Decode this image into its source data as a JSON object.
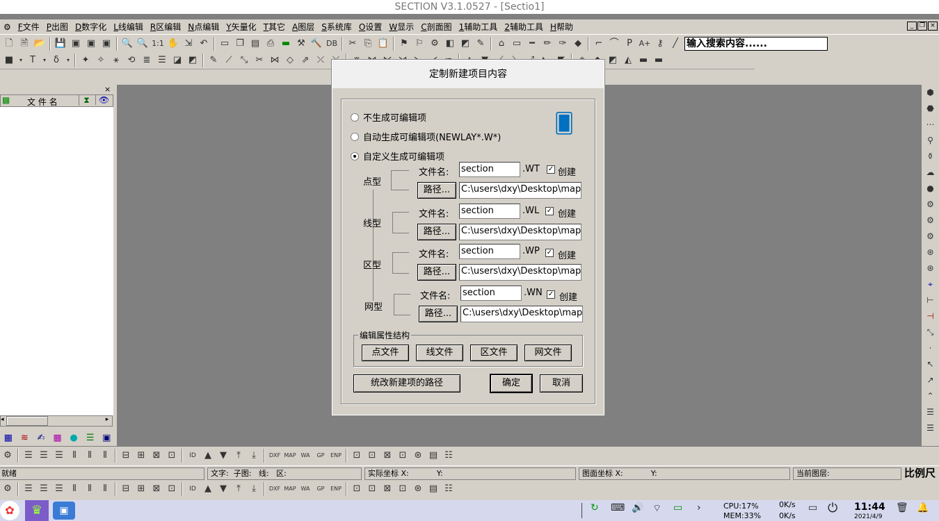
{
  "app": {
    "title": "SECTION V3.1.0527 - [Sectio1]"
  },
  "menu": {
    "items": [
      {
        "key": "F",
        "label": "文件"
      },
      {
        "key": "P",
        "label": "出图"
      },
      {
        "key": "D",
        "label": "数字化"
      },
      {
        "key": "L",
        "label": "线编辑"
      },
      {
        "key": "R",
        "label": "区编辑"
      },
      {
        "key": "N",
        "label": "点编辑"
      },
      {
        "key": "Y",
        "label": "矢量化"
      },
      {
        "key": "T",
        "label": "其它"
      },
      {
        "key": "A",
        "label": "图层"
      },
      {
        "key": "S",
        "label": "系统库"
      },
      {
        "key": "O",
        "label": "设置"
      },
      {
        "key": "W",
        "label": "显示"
      },
      {
        "key": "C",
        "label": "剖面图"
      },
      {
        "key": "1",
        "label": "辅助工具"
      },
      {
        "key": "2",
        "label": "辅助工具"
      },
      {
        "key": "H",
        "label": "帮助"
      }
    ]
  },
  "toolbar": {
    "search_value": "输入搜索内容......",
    "zoom_label": "1:1",
    "db_label": "DB"
  },
  "left_panel": {
    "column_header": "文 件 名"
  },
  "status": {
    "ready": "就绪",
    "text_label": "文字:",
    "subgraph_label": "子图:",
    "line_label": "线:",
    "area_label": "区:",
    "real_coord_label": "实际坐标 X:",
    "real_coord_y": "Y:",
    "map_coord_label": "图面坐标 X:",
    "map_coord_y": "Y:",
    "current_layer_label": "当前图层:",
    "scale_label": "比例尺"
  },
  "toolbar_bottom": {
    "labels": [
      "ID",
      "DXF",
      "MAP",
      "WA",
      "GP",
      "ENP"
    ]
  },
  "taskbar": {
    "cpu": "CPU:17%",
    "mem": "MEM:33%",
    "net_up": "0K/s",
    "net_down": "0K/s",
    "time": "11:44",
    "date": "2021/4/9"
  },
  "dialog": {
    "title": "定制新建项目内容",
    "radio_none": "不生成可编辑项",
    "radio_auto": "自动生成可编辑项(NEWLAY*.W*)",
    "radio_custom": "自定义生成可编辑项",
    "selected": "custom",
    "file_label": "文件名:",
    "path_button": "路径...",
    "create_label": "创建",
    "rows": [
      {
        "type": "点型",
        "name": "section",
        "ext": ".WT",
        "path": "C:\\users\\dxy\\Desktop\\map",
        "create": true
      },
      {
        "type": "线型",
        "name": "section",
        "ext": ".WL",
        "path": "C:\\users\\dxy\\Desktop\\map",
        "create": true
      },
      {
        "type": "区型",
        "name": "section",
        "ext": ".WP",
        "path": "C:\\users\\dxy\\Desktop\\map",
        "create": true
      },
      {
        "type": "网型",
        "name": "section",
        "ext": ".WN",
        "path": "C:\\users\\dxy\\Desktop\\map",
        "create": true
      }
    ],
    "group_label": "编辑属性结构",
    "btn_point": "点文件",
    "btn_line": "线文件",
    "btn_area": "区文件",
    "btn_net": "网文件",
    "btn_unify": "统改新建项的路径",
    "btn_ok": "确定",
    "btn_cancel": "取消"
  }
}
